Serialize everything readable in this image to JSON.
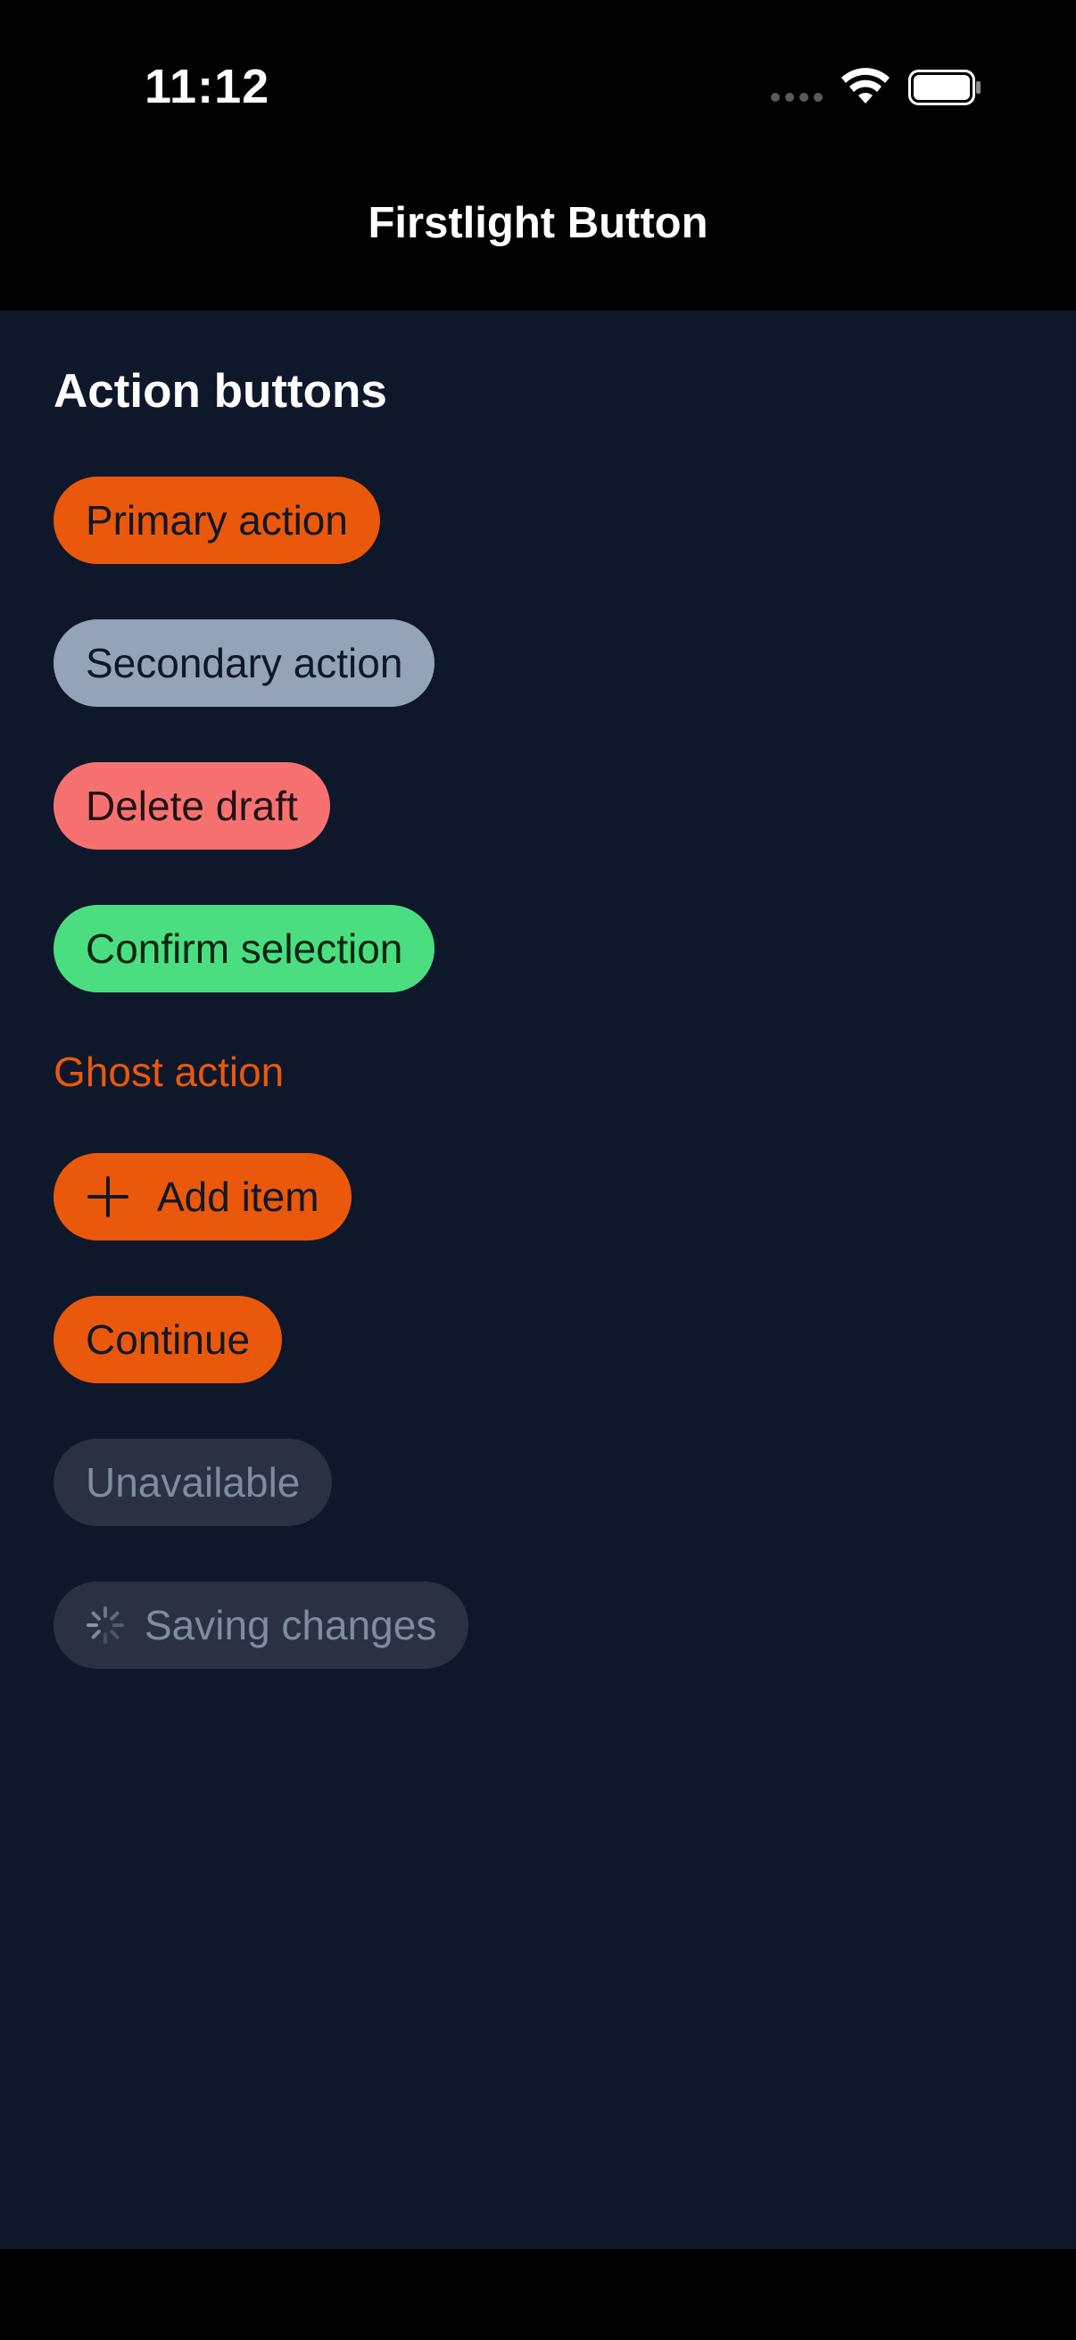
{
  "status_bar": {
    "time": "11:12",
    "icons": [
      "signal-icon",
      "wifi-icon",
      "battery-icon"
    ]
  },
  "nav": {
    "title": "Firstlight Button"
  },
  "content": {
    "section_title": "Action buttons",
    "buttons": {
      "primary": "Primary action",
      "secondary": "Secondary action",
      "danger": "Delete draft",
      "success": "Confirm selection",
      "ghost": "Ghost action",
      "add_item": "Add item",
      "continue": "Continue",
      "disabled": "Unavailable",
      "loading": "Saving changes"
    }
  },
  "colors": {
    "background": "#0f172a",
    "primary": "#ea580c",
    "secondary": "#94a3b8",
    "danger": "#f87171",
    "success": "#4ade80",
    "disabled": "#2a3142"
  }
}
